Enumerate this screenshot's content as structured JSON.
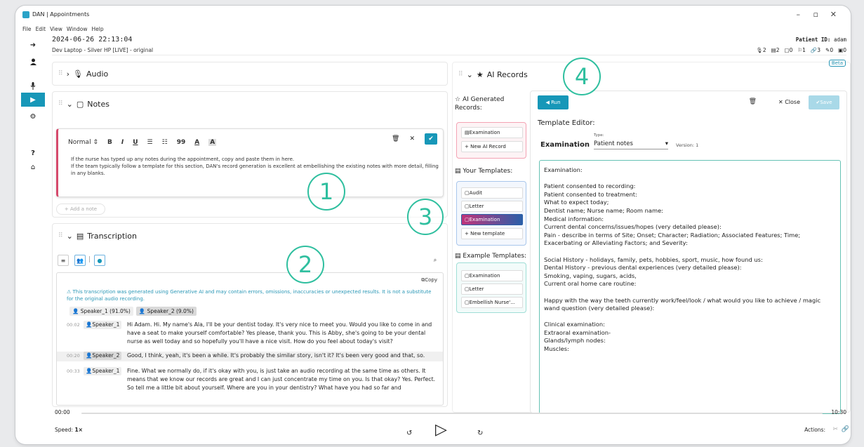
{
  "window": {
    "title": "DAN | Appointments",
    "controls": {
      "minimize": "–",
      "maximize": "▫",
      "close": "✕"
    }
  },
  "menu": [
    "File",
    "Edit",
    "View",
    "Window",
    "Help"
  ],
  "sidebar": {
    "icons": [
      "arrow-right-icon",
      "user-icon",
      "microphone-icon",
      "play-icon",
      "gears-icon",
      "help-icon",
      "home-icon"
    ],
    "active": "play-icon"
  },
  "session": {
    "datetime": "2024-06-26 22:13:04",
    "device": "Dev Laptop - Silver HP [LIVE] - original",
    "patient_label": "Patient ID:",
    "patient_id": "adam",
    "counts": [
      "2",
      "2",
      "0",
      "1",
      "3",
      "0",
      "0"
    ]
  },
  "audio": {
    "title": "Audio"
  },
  "notes": {
    "title": "Notes",
    "toolbar": {
      "style": "Normal",
      "bold": "B",
      "italic": "I",
      "underline": "U",
      "quote": "99",
      "text_color": "A",
      "highlight": "A"
    },
    "text_line1": "If the nurse has typed up any notes during the appointment, copy and paste them in here.",
    "text_line2": "If the team typically follow a template for this section, DAN's record generation is excellent at embellishing the existing notes with more detail, filling in any blanks.",
    "add_note": "+ Add a note"
  },
  "transcription": {
    "title": "Transcription",
    "copy": "Copy",
    "warning": "This transcription was generated using Generative AI and may contain errors, omissions, inaccuracies or unexpected results. It is not a substitute for the original audio recording.",
    "speakers": [
      {
        "label": "Speaker_1 (91.0%)"
      },
      {
        "label": "Speaker_2 (9.0%)"
      }
    ],
    "lines": [
      {
        "time": "00:02",
        "speaker": "Speaker_1",
        "text": "Hi Adam. Hi. My name's Ala, I'll be your dentist today. It's very nice to meet you. Would you like to come in and have a seat to make yourself comfortable? Yes please, thank you. This is Abby, she's going to be your dental nurse as well today and so hopefully you'll have a nice visit. How do you feel about today's visit?"
      },
      {
        "time": "00:20",
        "speaker": "Speaker_2",
        "text": "Good, I think, yeah, it's been a while. It's probably the similar story, isn't it? It's been very good and that, so."
      },
      {
        "time": "00:33",
        "speaker": "Speaker_1",
        "text": "Fine. What we normally do, if it's okay with you, is just take an audio recording at the same time as others. It means that we know our records are great and I can just concentrate my time on you. Is that okay? Yes. Perfect. So tell me a little bit about yourself. Where are you in your dentistry? What have you had so far and"
      }
    ]
  },
  "ai_records": {
    "title": "AI Records",
    "beta": "Beta",
    "generated_label": "AI Generated Records:",
    "generated": [
      "Examination",
      "+ New AI Record"
    ],
    "your_label": "Your Templates:",
    "your": [
      "Audit",
      "Letter",
      "Examination",
      "+ New template"
    ],
    "example_label": "Example Templates:",
    "examples": [
      "Examination",
      "Letter",
      "Embellish Nurse'..."
    ]
  },
  "editor": {
    "run": "Run",
    "close": "Close",
    "save": "Save",
    "label": "Template Editor:",
    "name": "Examination",
    "type_label": "Type:",
    "type_value": "Patient notes",
    "version": "Version: 1",
    "content": "Examination:\n\nPatient consented to recording:\nPatient consented to treatment:\nWhat to expect today;\nDentist name; Nurse name; Room name:\nMedical information:\nCurrent dental concerns/issues/hopes (very detailed please):\nPain - describe in terms of Site; Onset; Character; Radiation; Associated Features; Time; Exacerbating or Alleviating Factors; and Severity:\n\nSocial History - holidays, family, pets, hobbies, sport, music, how found us:\nDental History - previous dental experiences (very detailed please):\nSmoking, vaping, sugars, acids,\nCurrent oral home care routine:\n\nHappy with the way the teeth currently work/feel/look / what would you like to achieve / magic wand question (very detailed please):\n\nClinical examination:\nExtraoral examination-\nGlands/lymph nodes:\nMuscles:"
  },
  "player": {
    "start": "00:00",
    "end": "10:30",
    "speed_label": "Speed:",
    "speed_value": "1×",
    "actions_label": "Actions:",
    "progress": 0
  },
  "callouts": [
    "1",
    "2",
    "3",
    "4"
  ],
  "colors": {
    "accent": "#1797b8",
    "callout": "#2fbf9f",
    "notes_border": "#d64a6c",
    "generated_box": "#f4a3b4",
    "your_box": "#a9c7ec",
    "example_box": "#9fded6"
  }
}
